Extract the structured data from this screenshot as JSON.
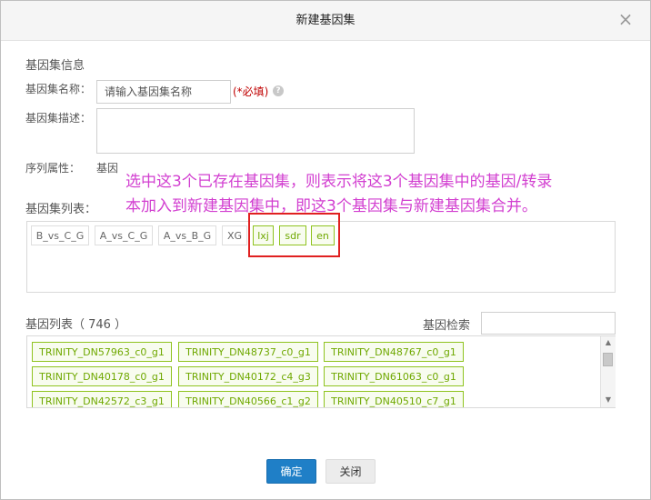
{
  "dialog": {
    "title": "新建基因集",
    "close_glyph": "×"
  },
  "info_section": {
    "heading": "基因集信息",
    "name_label": "基因集名称：",
    "name_placeholder": "请输入基因集名称",
    "required_text": "(*必填)",
    "help_glyph": "?",
    "desc_label": "基因集描述：",
    "seq_attr_label": "序列属性：",
    "seq_attr_value": "基因"
  },
  "annotation": {
    "line1": "选中这3个已存在基因集，则表示将这3个基因集中的基因/转录",
    "line2": "本加入到新建基因集中，即这3个基因集与新建基因集合并。",
    "color": "#d23fd0"
  },
  "gene_sets": {
    "label": "基因集列表：",
    "items": [
      {
        "label": "B_vs_C_G",
        "selected": false
      },
      {
        "label": "A_vs_C_G",
        "selected": false
      },
      {
        "label": "A_vs_B_G",
        "selected": false
      },
      {
        "label": "XG",
        "selected": false
      },
      {
        "label": "lxj",
        "selected": true
      },
      {
        "label": "sdr",
        "selected": true
      },
      {
        "label": "en",
        "selected": true
      }
    ]
  },
  "gene_list": {
    "label": "基因列表（ 746 ）",
    "search_label": "基因检索",
    "rows": [
      [
        "TRINITY_DN57963_c0_g1",
        "TRINITY_DN48737_c0_g1",
        "TRINITY_DN48767_c0_g1"
      ],
      [
        "TRINITY_DN40178_c0_g1",
        "TRINITY_DN40172_c4_g3",
        "TRINITY_DN61063_c0_g1"
      ],
      [
        "TRINITY_DN42572_c3_g1",
        "TRINITY_DN40566_c1_g2",
        "TRINITY_DN40510_c7_g1"
      ]
    ]
  },
  "buttons": {
    "confirm": "确定",
    "close": "关闭"
  },
  "colors": {
    "accent_blue": "#1f7fc7",
    "selected_green": "#8fc31f",
    "highlight_red": "#e02020",
    "required_red": "#c00000"
  }
}
